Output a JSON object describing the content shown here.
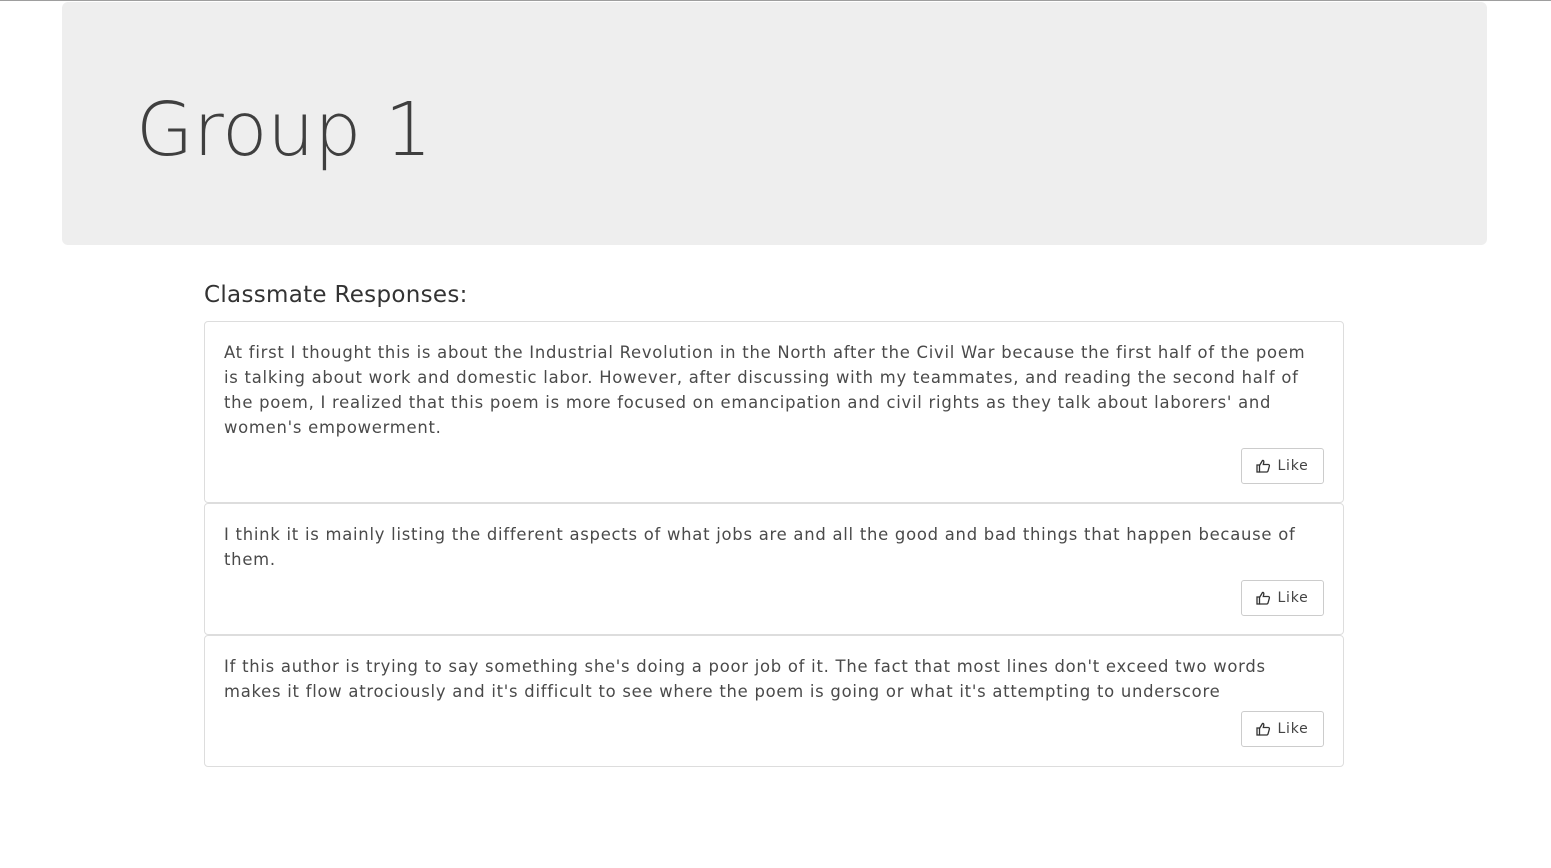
{
  "header": {
    "title": "Group 1"
  },
  "responses": {
    "heading": "Classmate Responses:",
    "items": [
      {
        "text": "At first I thought this is about the Industrial Revolution in the North after the Civil War because the first half of the poem is talking about work and domestic labor. However, after discussing with my teammates, and reading the second half of the poem, I realized that this poem is more focused on emancipation and civil rights as they talk about laborers' and women's empowerment.",
        "like_label": "Like"
      },
      {
        "text": "I think it is mainly listing the different aspects of what jobs are and all the good and bad things that happen because of them.",
        "like_label": "Like"
      },
      {
        "text": "If this author is trying to say something she's doing a poor job of it. The fact that most lines don't exceed two words makes it flow atrociously and it's difficult to see where the poem is going or what it's attempting to underscore",
        "like_label": "Like"
      }
    ]
  },
  "icons": {
    "like": "thumbs-up-icon"
  }
}
